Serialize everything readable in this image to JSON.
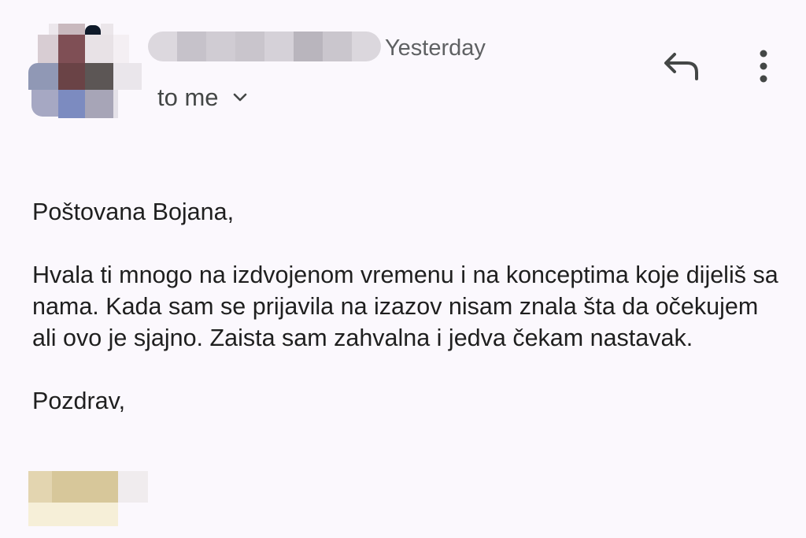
{
  "email": {
    "sender": {
      "name": "",
      "avatar": "avatar-blurred"
    },
    "timestamp": "Yesterday",
    "recipient_label": "to me",
    "actions": {
      "reply_icon": "reply-icon",
      "more_icon": "more-vert-icon",
      "expand_icon": "chevron-down-icon"
    },
    "body": {
      "greeting": "Poštovana Bojana,",
      "message": "Hvala ti mnogo na izdvojenom vremenu i na konceptima koje dijeliš sa nama. Kada sam se prijavila na izazov nisam znala šta da očekujem ali ovo je sjajno. Zaista sam zahvalna i jedva čekam nastavak.",
      "closing": "Pozdrav,"
    },
    "signature": {
      "name": ""
    }
  },
  "colors": {
    "background": "#fbf8fd",
    "text_primary": "#1f1f1f",
    "text_secondary": "#5f6163",
    "icon": "#444746"
  }
}
